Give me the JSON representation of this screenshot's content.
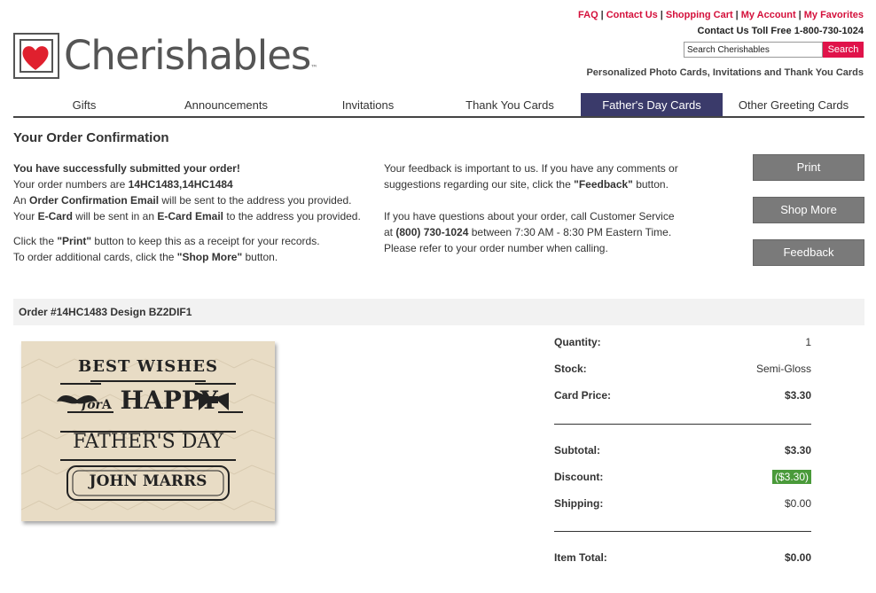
{
  "header": {
    "links": [
      "FAQ",
      "Contact Us",
      "Shopping Cart",
      "My Account",
      "My Favorites"
    ],
    "toll_free": "Contact Us Toll Free 1-800-730-1024",
    "search_placeholder": "Search Cherishables",
    "search_button": "Search",
    "tagline": "Personalized Photo Cards, Invitations and Thank You Cards",
    "logo_text": "Cherishables",
    "logo_tm": "™"
  },
  "nav": {
    "items": [
      "Gifts",
      "Announcements",
      "Invitations",
      "Thank You Cards",
      "Father's Day Cards",
      "Other Greeting Cards"
    ],
    "active_index": 4
  },
  "page": {
    "title": "Your Order Confirmation"
  },
  "left": {
    "success": "You have successfully submitted your order!",
    "order_numbers_prefix": "Your order numbers are ",
    "order_numbers": "14HC1483,14HC1484",
    "email_prefix": "An ",
    "email_bold": "Order Confirmation Email",
    "email_suffix": " will be sent to the address you provided.",
    "ecard_prefix": "Your ",
    "ecard_bold1": "E-Card",
    "ecard_mid": " will be sent in an ",
    "ecard_bold2": "E-Card Email",
    "ecard_suffix": " to the address you provided.",
    "print_prefix": "Click the ",
    "print_bold": "\"Print\"",
    "print_suffix": " button to keep this as a receipt for your records.",
    "shop_prefix": "To order additional cards, click the ",
    "shop_bold": "\"Shop More\"",
    "shop_suffix": " button."
  },
  "right": {
    "feedback_line1": "Your feedback is important to us. If you have any comments or",
    "feedback_line2_prefix": "suggestions regarding our site, click the ",
    "feedback_bold": "\"Feedback\"",
    "feedback_line2_suffix": " button.",
    "questions_line1": "If you have questions about your order, call Customer Service",
    "questions_prefix": "at ",
    "questions_phone": "(800) 730-1024",
    "questions_suffix": " between 7:30 AM - 8:30 PM Eastern Time.",
    "questions_line3": "Please refer to your order number when calling."
  },
  "buttons": {
    "print": "Print",
    "shop_more": "Shop More",
    "feedback": "Feedback"
  },
  "order": {
    "header": "Order #14HC1483 Design BZ2DIF1",
    "card": {
      "line1": "BEST WISHES",
      "for": "for",
      "a": "A",
      "happy": "HAPPY",
      "fathers_day": "FATHER'S DAY",
      "name": "JOHN MARRS"
    },
    "quantity_label": "Quantity:",
    "quantity": "1",
    "stock_label": "Stock:",
    "stock": "Semi-Gloss",
    "card_price_label": "Card Price:",
    "card_price": "$3.30",
    "subtotal_label": "Subtotal:",
    "subtotal": "$3.30",
    "discount_label": "Discount:",
    "discount": "($3.30)",
    "shipping_label": "Shipping:",
    "shipping": "$0.00",
    "item_total_label": "Item Total:",
    "item_total": "$0.00"
  },
  "colors": {
    "brand_red": "#d4103b",
    "nav_active": "#3a3a6a",
    "button_gray": "#7a7a7a",
    "discount_green": "#4a9a3a"
  }
}
